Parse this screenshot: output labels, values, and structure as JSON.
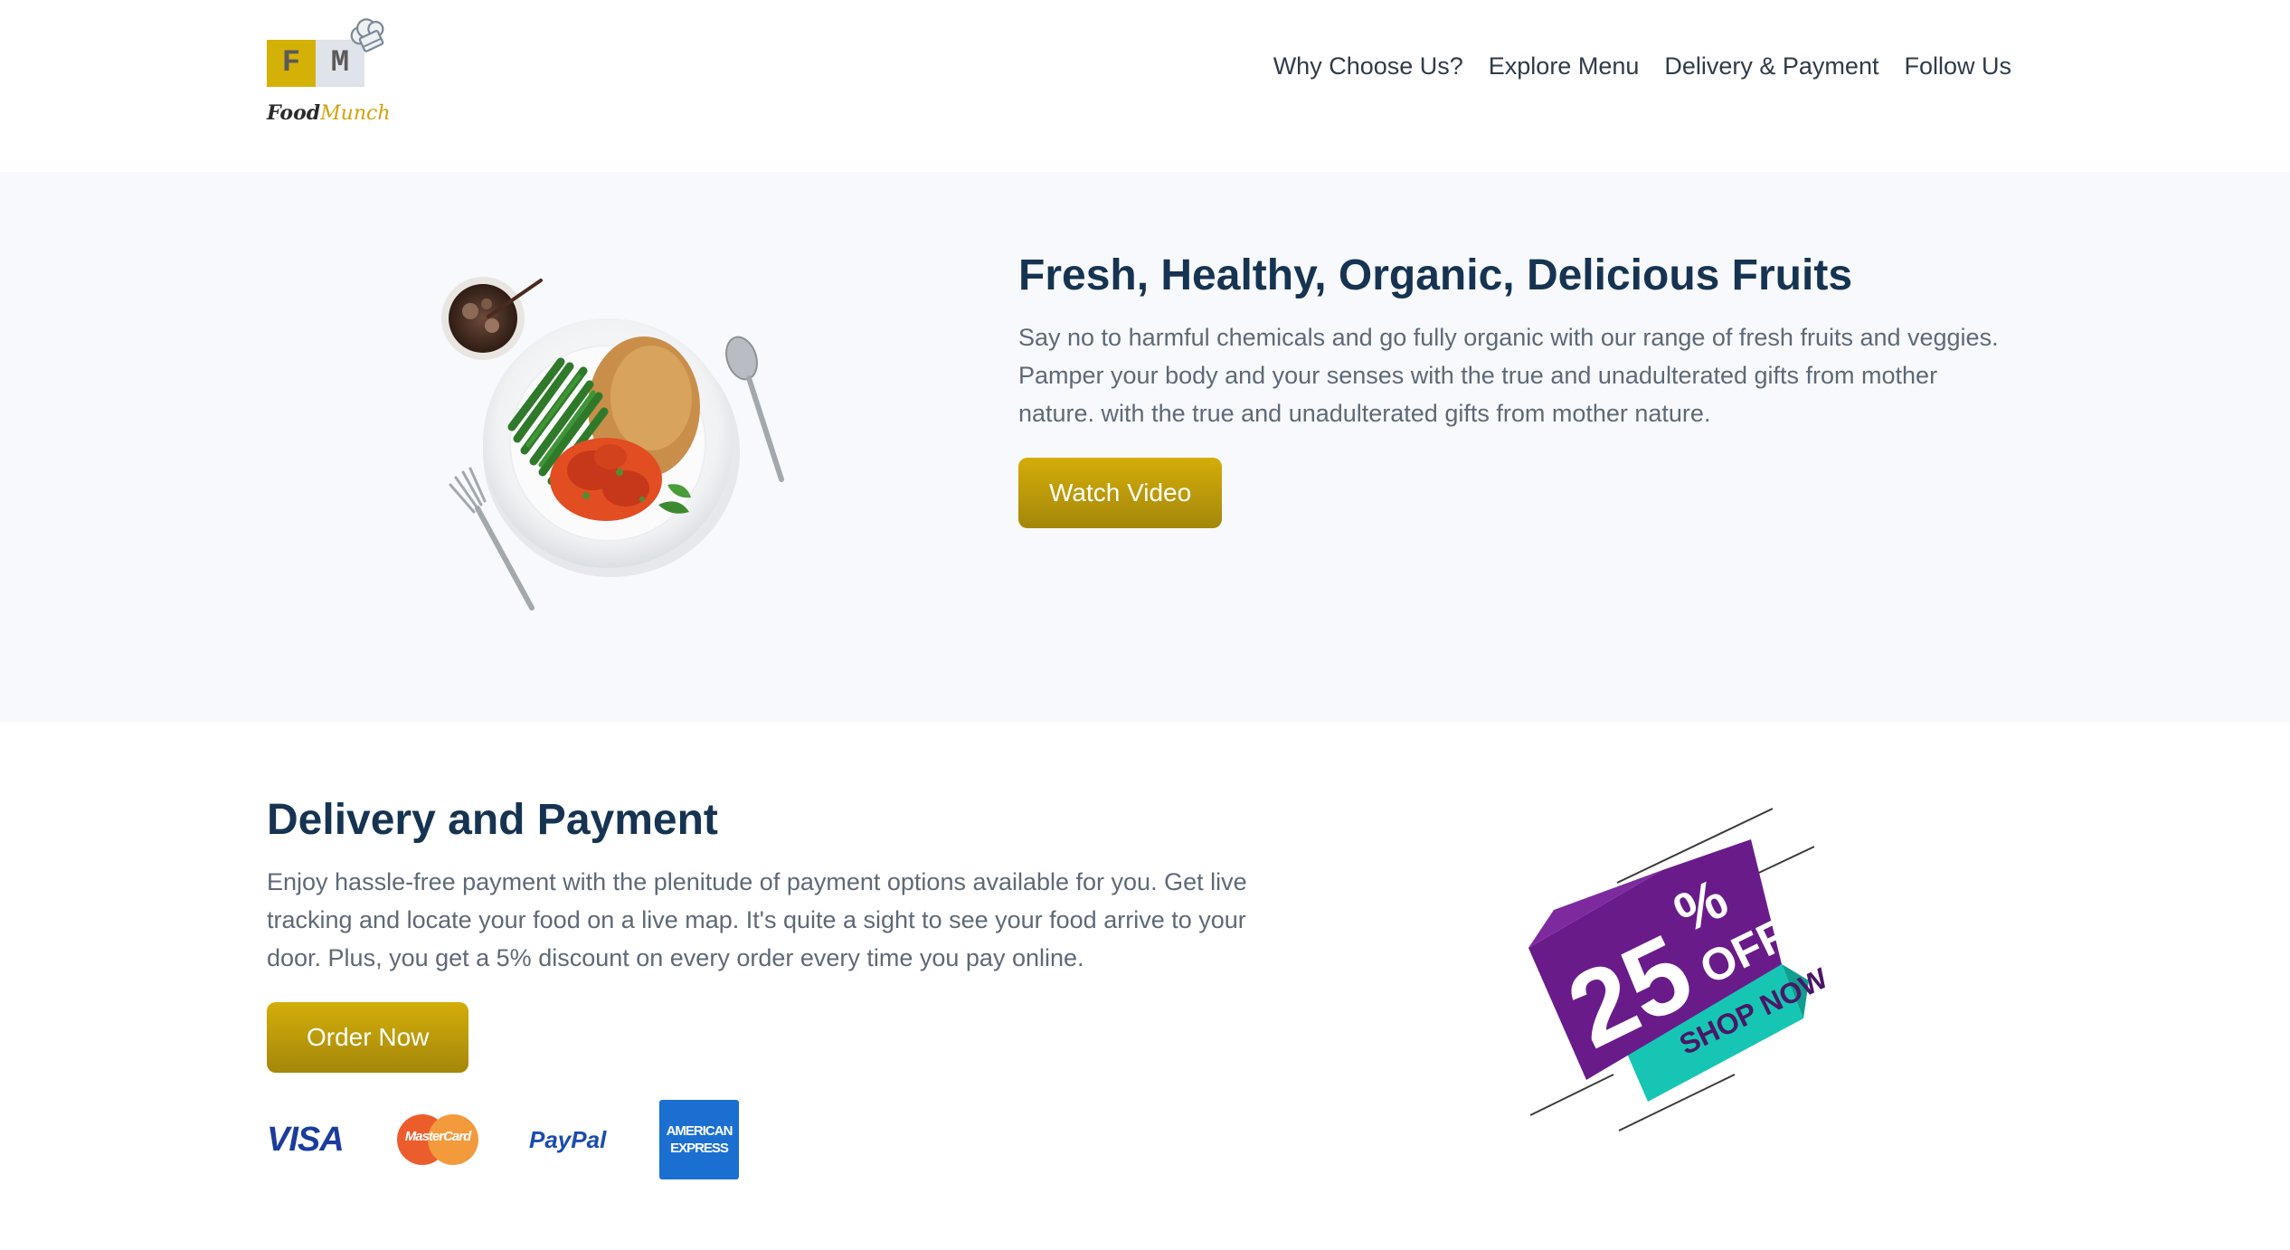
{
  "brand": {
    "letter_f": "F",
    "letter_m": "M",
    "name_part1": "Food",
    "name_part2": "Munch",
    "colors": {
      "gold": "#d4b106",
      "grey_box": "#dfe3ea"
    }
  },
  "nav": {
    "links": [
      "Why Choose Us?",
      "Explore Menu",
      "Delivery & Payment",
      "Follow Us"
    ]
  },
  "banner": {
    "title": "Fresh, Healthy, Organic, Delicious Fruits",
    "description": "Say no to harmful chemicals and go fully organic with our range of fresh fruits and veggies. Pamper your body and your senses with the true and unadulterated gifts from mother nature. with the true and unadulterated gifts from mother nature.",
    "button_label": "Watch Video"
  },
  "delivery": {
    "title": "Delivery and Payment",
    "description": "Enjoy hassle-free payment with the plenitude of payment options available for you. Get live tracking and locate your food on a live map. It's quite a sight to see your food arrive to your door. Plus, you get a 5% discount on every order every time you pay online.",
    "button_label": "Order Now",
    "payments": {
      "visa": "VISA",
      "mastercard": "MasterCard",
      "paypal": "PayPal",
      "amex_line1": "AMERICAN",
      "amex_line2": "EXPRESS"
    }
  },
  "promo": {
    "value": "25",
    "percent": "%",
    "off": "OFF",
    "cta": "SHOP NOW",
    "colors": {
      "purple": "#6a1b8a",
      "teal": "#17c5b4"
    }
  },
  "theme": {
    "accent": "#c9a508",
    "heading": "#163452",
    "body_text": "#5e6977",
    "banner_bg": "#f8f9fc"
  }
}
